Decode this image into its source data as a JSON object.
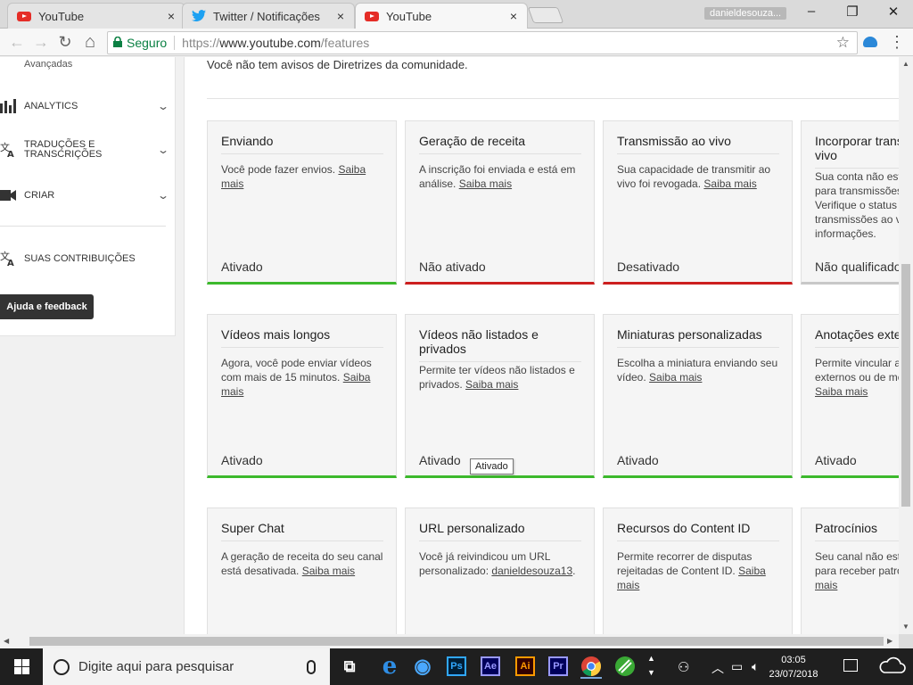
{
  "browser": {
    "tabs": [
      {
        "title": "YouTube",
        "icon": "youtube-icon",
        "active": false
      },
      {
        "title": "Twitter / Notificações",
        "icon": "twitter-icon",
        "active": false
      },
      {
        "title": "YouTube",
        "icon": "youtube-icon",
        "active": true
      }
    ],
    "close_glyph": "×",
    "profile_name": "danieldesouza...",
    "window_controls": {
      "minimize": "–",
      "restore": "❐",
      "close": "✕"
    },
    "nav": {
      "back": "←",
      "forward": "→",
      "reload": "↻",
      "home": "⌂"
    },
    "secure_label": "Seguro",
    "url_prefix": "https://",
    "url_host": "www.youtube.com",
    "url_path": "/features",
    "bookmark_star": "☆",
    "menu": "⋮"
  },
  "sidebar": {
    "sub_label": "Avançadas",
    "items": [
      {
        "label": "ANALYTICS",
        "icon": "bar-chart-icon",
        "expandable": true
      },
      {
        "label": "TRADUÇÕES E TRANSCRIÇÕES",
        "icon": "translate-icon",
        "expandable": true
      },
      {
        "label": "CRIAR",
        "icon": "video-camera-icon",
        "expandable": true
      },
      {
        "label": "SUAS CONTRIBUIÇÕES",
        "icon": "translate-icon",
        "expandable": false
      }
    ],
    "chevron": "⌄",
    "help_button": "Ajuda e feedback"
  },
  "content": {
    "notice": "Você não tem avisos de Diretrizes da comunidade.",
    "cards": [
      {
        "title": "Enviando",
        "desc": "Você pode fazer envios.",
        "link": "Saiba mais",
        "status": "Ativado",
        "state": "green"
      },
      {
        "title": "Geração de receita",
        "desc": "A inscrição foi enviada e está em análise.",
        "link": "Saiba mais",
        "status": "Não ativado",
        "state": "red"
      },
      {
        "title": "Transmissão ao vivo",
        "desc": "Sua capacidade de transmitir ao vivo foi revogada.",
        "link": "Saiba mais",
        "status": "Desativado",
        "state": "red"
      },
      {
        "title": "Incorporar transmissões ao vivo",
        "desc": "Sua conta não está qualificada para transmissões ao vivo. Verifique o status do recurso de transmissões ao vivo para mais informações.",
        "link": "",
        "status": "Não qualificado",
        "state": "gray"
      },
      {
        "title": "Vídeos mais longos",
        "desc": "Agora, você pode enviar vídeos com mais de 15 minutos.",
        "link": "Saiba mais",
        "status": "Ativado",
        "state": "green"
      },
      {
        "title": "Vídeos não listados e privados",
        "desc": "Permite ter vídeos não listados e privados.",
        "link": "Saiba mais",
        "status": "Ativado",
        "state": "green"
      },
      {
        "title": "Miniaturas personalizadas",
        "desc": "Escolha a miniatura enviando seu vídeo.",
        "link": "Saiba mais",
        "status": "Ativado",
        "state": "green"
      },
      {
        "title": "Anotações externas",
        "desc": "Permite vincular anotações a sites externos ou de merchandising.",
        "link": "Saiba mais",
        "status": "Ativado",
        "state": "green"
      },
      {
        "title": "Super Chat",
        "desc": "A geração de receita do seu canal está desativada.",
        "link": "Saiba mais",
        "status": "",
        "state": "none"
      },
      {
        "title": "URL personalizado",
        "desc": "Você já reivindicou um URL personalizado:",
        "link": "danieldesouza13",
        "trailing": ".",
        "status": "",
        "state": "none"
      },
      {
        "title": "Recursos do Content ID",
        "desc": "Permite recorrer de disputas rejeitadas de Content ID.",
        "link": "Saiba mais",
        "status": "",
        "state": "none"
      },
      {
        "title": "Patrocínios",
        "desc": "Seu canal não está qualificado para receber patrocínios.",
        "link": "Saiba mais",
        "status": "",
        "state": "none"
      }
    ],
    "tooltip": "Ativado"
  },
  "taskbar": {
    "search_placeholder": "Digite aqui para pesquisar",
    "apps": [
      {
        "name": "task-view",
        "label": "⧉"
      },
      {
        "name": "edge",
        "label": "e"
      },
      {
        "name": "media",
        "label": "◉"
      },
      {
        "name": "photoshop",
        "label": "Ps",
        "color": "#31a8ff"
      },
      {
        "name": "after-effects",
        "label": "Ae",
        "color": "#9999ff"
      },
      {
        "name": "illustrator",
        "label": "Ai",
        "color": "#ff9a00"
      },
      {
        "name": "premiere",
        "label": "Pr",
        "color": "#9999ff"
      },
      {
        "name": "chrome",
        "label": ""
      },
      {
        "name": "green-app",
        "label": ""
      }
    ],
    "time": "03:05",
    "date": "23/07/2018"
  },
  "colors": {
    "enabled": "#3cb92c",
    "disabled": "#cc1f1f",
    "not_eligible": "#c8c8c8",
    "secure": "#0b8043"
  }
}
